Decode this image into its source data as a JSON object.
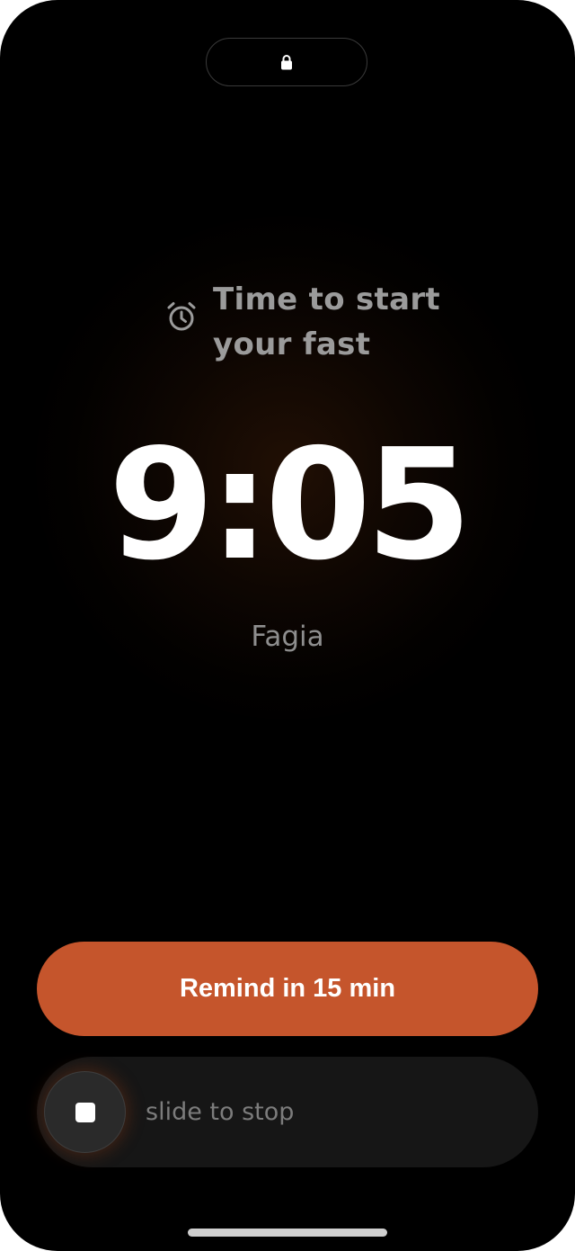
{
  "status": {
    "lock_icon": "lock-icon"
  },
  "alarm": {
    "icon": "alarm-clock-icon",
    "title_line1": "Time to start",
    "title_line2": "your fast"
  },
  "clock": {
    "time": "9:05"
  },
  "app": {
    "name": "Fagia"
  },
  "actions": {
    "remind_label": "Remind in 15 min",
    "slide_label": "slide to stop",
    "stop_icon": "stop-icon"
  },
  "colors": {
    "accent": "#c5552c",
    "background": "#000000",
    "secondary_text": "#9b9b9b"
  }
}
